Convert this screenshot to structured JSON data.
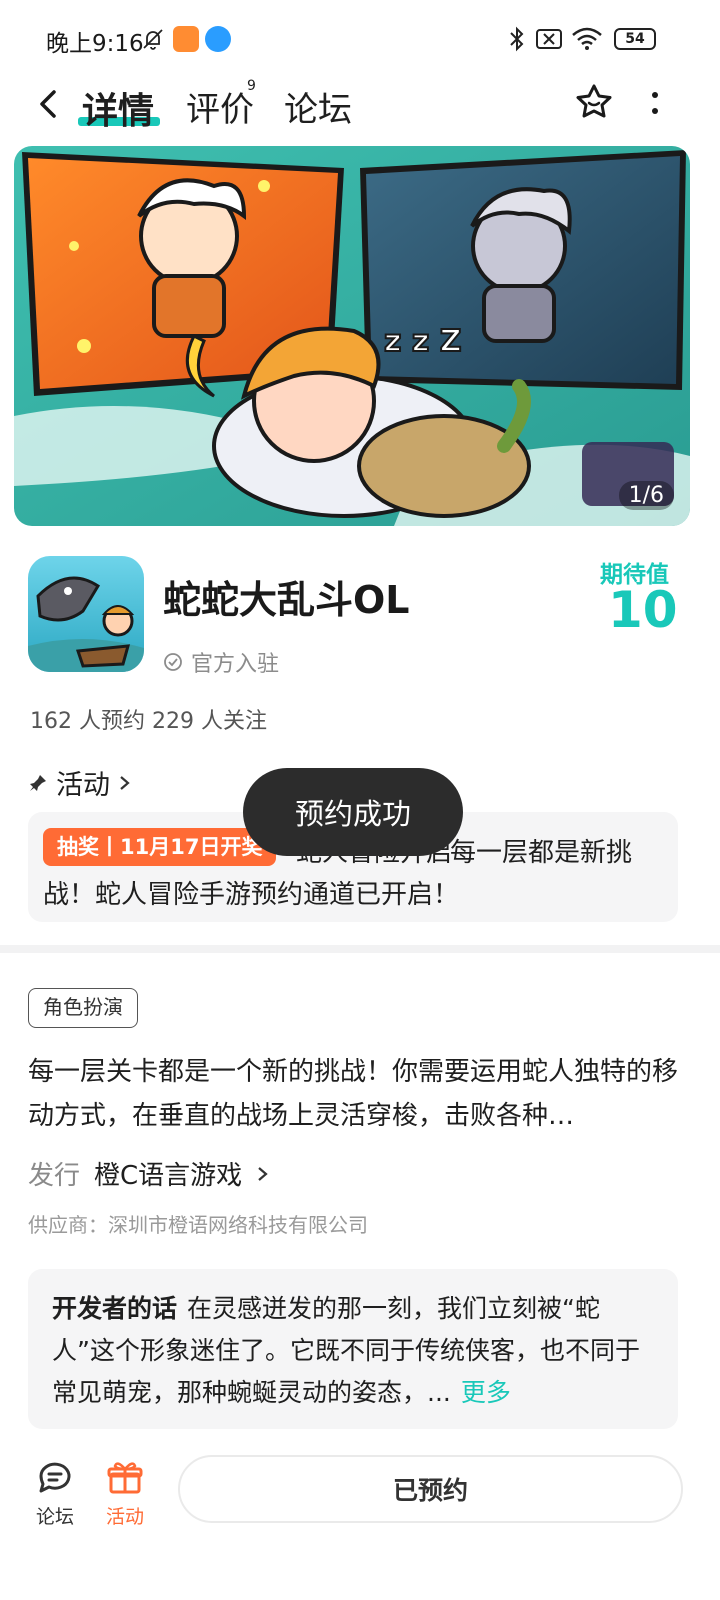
{
  "status_bar": {
    "time": "晚上9:16",
    "battery": "54",
    "icons": [
      "mute-bell-icon",
      "app-badge-orange",
      "app-badge-blue",
      "bluetooth-icon",
      "sim-off-icon",
      "wifi-icon",
      "battery-icon"
    ]
  },
  "nav": {
    "tabs": [
      {
        "label": "详情",
        "active": true
      },
      {
        "label": "评价",
        "sup": "9"
      },
      {
        "label": "论坛"
      }
    ],
    "icons": [
      "back-icon",
      "star-icon",
      "more-vertical-icon"
    ]
  },
  "banner": {
    "counter": "1/6"
  },
  "game": {
    "title": "蛇蛇大乱斗OL",
    "official": "官方入驻",
    "expect_label": "期待值",
    "expect_value": "10",
    "stats": "162 人预约   229 人关注"
  },
  "activity": {
    "header": "活动",
    "tag": "抽奖丨11月17日开奖",
    "text_line1_partial": "每一层都是新挑",
    "text_line1_hidden": "蛇人冒险开启",
    "text_line2": "战！蛇人冒险手游预约通道已开启！"
  },
  "toast": "预约成功",
  "genre_tag": "角色扮演",
  "description": "每一层关卡都是一个新的挑战！你需要运用蛇人独特的移动方式，在垂直的战场上灵活穿梭，击败各种…",
  "publisher": {
    "label": "发行",
    "name": "橙C语言游戏"
  },
  "supplier": "供应商：深圳市橙语网络科技有限公司",
  "developer": {
    "title": "开发者的话",
    "text": "在灵感迸发的那一刻，我们立刻被“蛇人”这个形象迷住了。它既不同于传统侠客，也不同于常见萌宠，那种蜿蜒灵动的姿态，...",
    "more": "更多"
  },
  "bottom": {
    "forum_label": "论坛",
    "activity_label": "活动",
    "reserve_label": "已预约"
  },
  "colors": {
    "accent": "#19c8b9",
    "orange": "#ff6b35",
    "toast_bg": "#2c2c2c"
  }
}
